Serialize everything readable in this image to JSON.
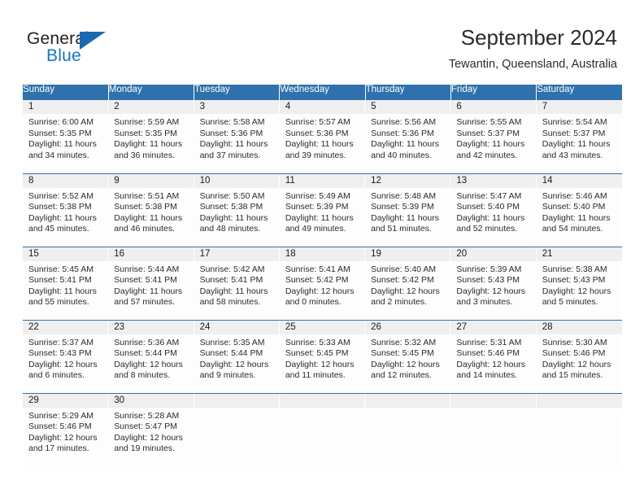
{
  "logo": {
    "word_top": "General",
    "word_bottom": "Blue",
    "triangle_color": "#1b69b0",
    "text_color": "#231f20",
    "blue_text_color": "#1278be"
  },
  "header": {
    "title": "September 2024",
    "subtitle": "Tewantin, Queensland, Australia"
  },
  "theme": {
    "header_blue": "#2f71ac",
    "daynum_band": "#efefef",
    "cell_background": "#fdfdfd",
    "text": "#2b2b2b"
  },
  "weekday_headers": [
    "Sunday",
    "Monday",
    "Tuesday",
    "Wednesday",
    "Thursday",
    "Friday",
    "Saturday"
  ],
  "weeks": [
    [
      {
        "day": "1",
        "sunrise": "Sunrise: 6:00 AM",
        "sunset": "Sunset: 5:35 PM",
        "daylight_line1": "Daylight: 11 hours",
        "daylight_line2": "and 34 minutes."
      },
      {
        "day": "2",
        "sunrise": "Sunrise: 5:59 AM",
        "sunset": "Sunset: 5:35 PM",
        "daylight_line1": "Daylight: 11 hours",
        "daylight_line2": "and 36 minutes."
      },
      {
        "day": "3",
        "sunrise": "Sunrise: 5:58 AM",
        "sunset": "Sunset: 5:36 PM",
        "daylight_line1": "Daylight: 11 hours",
        "daylight_line2": "and 37 minutes."
      },
      {
        "day": "4",
        "sunrise": "Sunrise: 5:57 AM",
        "sunset": "Sunset: 5:36 PM",
        "daylight_line1": "Daylight: 11 hours",
        "daylight_line2": "and 39 minutes."
      },
      {
        "day": "5",
        "sunrise": "Sunrise: 5:56 AM",
        "sunset": "Sunset: 5:36 PM",
        "daylight_line1": "Daylight: 11 hours",
        "daylight_line2": "and 40 minutes."
      },
      {
        "day": "6",
        "sunrise": "Sunrise: 5:55 AM",
        "sunset": "Sunset: 5:37 PM",
        "daylight_line1": "Daylight: 11 hours",
        "daylight_line2": "and 42 minutes."
      },
      {
        "day": "7",
        "sunrise": "Sunrise: 5:54 AM",
        "sunset": "Sunset: 5:37 PM",
        "daylight_line1": "Daylight: 11 hours",
        "daylight_line2": "and 43 minutes."
      }
    ],
    [
      {
        "day": "8",
        "sunrise": "Sunrise: 5:52 AM",
        "sunset": "Sunset: 5:38 PM",
        "daylight_line1": "Daylight: 11 hours",
        "daylight_line2": "and 45 minutes."
      },
      {
        "day": "9",
        "sunrise": "Sunrise: 5:51 AM",
        "sunset": "Sunset: 5:38 PM",
        "daylight_line1": "Daylight: 11 hours",
        "daylight_line2": "and 46 minutes."
      },
      {
        "day": "10",
        "sunrise": "Sunrise: 5:50 AM",
        "sunset": "Sunset: 5:38 PM",
        "daylight_line1": "Daylight: 11 hours",
        "daylight_line2": "and 48 minutes."
      },
      {
        "day": "11",
        "sunrise": "Sunrise: 5:49 AM",
        "sunset": "Sunset: 5:39 PM",
        "daylight_line1": "Daylight: 11 hours",
        "daylight_line2": "and 49 minutes."
      },
      {
        "day": "12",
        "sunrise": "Sunrise: 5:48 AM",
        "sunset": "Sunset: 5:39 PM",
        "daylight_line1": "Daylight: 11 hours",
        "daylight_line2": "and 51 minutes."
      },
      {
        "day": "13",
        "sunrise": "Sunrise: 5:47 AM",
        "sunset": "Sunset: 5:40 PM",
        "daylight_line1": "Daylight: 11 hours",
        "daylight_line2": "and 52 minutes."
      },
      {
        "day": "14",
        "sunrise": "Sunrise: 5:46 AM",
        "sunset": "Sunset: 5:40 PM",
        "daylight_line1": "Daylight: 11 hours",
        "daylight_line2": "and 54 minutes."
      }
    ],
    [
      {
        "day": "15",
        "sunrise": "Sunrise: 5:45 AM",
        "sunset": "Sunset: 5:41 PM",
        "daylight_line1": "Daylight: 11 hours",
        "daylight_line2": "and 55 minutes."
      },
      {
        "day": "16",
        "sunrise": "Sunrise: 5:44 AM",
        "sunset": "Sunset: 5:41 PM",
        "daylight_line1": "Daylight: 11 hours",
        "daylight_line2": "and 57 minutes."
      },
      {
        "day": "17",
        "sunrise": "Sunrise: 5:42 AM",
        "sunset": "Sunset: 5:41 PM",
        "daylight_line1": "Daylight: 11 hours",
        "daylight_line2": "and 58 minutes."
      },
      {
        "day": "18",
        "sunrise": "Sunrise: 5:41 AM",
        "sunset": "Sunset: 5:42 PM",
        "daylight_line1": "Daylight: 12 hours",
        "daylight_line2": "and 0 minutes."
      },
      {
        "day": "19",
        "sunrise": "Sunrise: 5:40 AM",
        "sunset": "Sunset: 5:42 PM",
        "daylight_line1": "Daylight: 12 hours",
        "daylight_line2": "and 2 minutes."
      },
      {
        "day": "20",
        "sunrise": "Sunrise: 5:39 AM",
        "sunset": "Sunset: 5:43 PM",
        "daylight_line1": "Daylight: 12 hours",
        "daylight_line2": "and 3 minutes."
      },
      {
        "day": "21",
        "sunrise": "Sunrise: 5:38 AM",
        "sunset": "Sunset: 5:43 PM",
        "daylight_line1": "Daylight: 12 hours",
        "daylight_line2": "and 5 minutes."
      }
    ],
    [
      {
        "day": "22",
        "sunrise": "Sunrise: 5:37 AM",
        "sunset": "Sunset: 5:43 PM",
        "daylight_line1": "Daylight: 12 hours",
        "daylight_line2": "and 6 minutes."
      },
      {
        "day": "23",
        "sunrise": "Sunrise: 5:36 AM",
        "sunset": "Sunset: 5:44 PM",
        "daylight_line1": "Daylight: 12 hours",
        "daylight_line2": "and 8 minutes."
      },
      {
        "day": "24",
        "sunrise": "Sunrise: 5:35 AM",
        "sunset": "Sunset: 5:44 PM",
        "daylight_line1": "Daylight: 12 hours",
        "daylight_line2": "and 9 minutes."
      },
      {
        "day": "25",
        "sunrise": "Sunrise: 5:33 AM",
        "sunset": "Sunset: 5:45 PM",
        "daylight_line1": "Daylight: 12 hours",
        "daylight_line2": "and 11 minutes."
      },
      {
        "day": "26",
        "sunrise": "Sunrise: 5:32 AM",
        "sunset": "Sunset: 5:45 PM",
        "daylight_line1": "Daylight: 12 hours",
        "daylight_line2": "and 12 minutes."
      },
      {
        "day": "27",
        "sunrise": "Sunrise: 5:31 AM",
        "sunset": "Sunset: 5:46 PM",
        "daylight_line1": "Daylight: 12 hours",
        "daylight_line2": "and 14 minutes."
      },
      {
        "day": "28",
        "sunrise": "Sunrise: 5:30 AM",
        "sunset": "Sunset: 5:46 PM",
        "daylight_line1": "Daylight: 12 hours",
        "daylight_line2": "and 15 minutes."
      }
    ],
    [
      {
        "day": "29",
        "sunrise": "Sunrise: 5:29 AM",
        "sunset": "Sunset: 5:46 PM",
        "daylight_line1": "Daylight: 12 hours",
        "daylight_line2": "and 17 minutes."
      },
      {
        "day": "30",
        "sunrise": "Sunrise: 5:28 AM",
        "sunset": "Sunset: 5:47 PM",
        "daylight_line1": "Daylight: 12 hours",
        "daylight_line2": "and 19 minutes."
      },
      {
        "day": "",
        "sunrise": "",
        "sunset": "",
        "daylight_line1": "",
        "daylight_line2": ""
      },
      {
        "day": "",
        "sunrise": "",
        "sunset": "",
        "daylight_line1": "",
        "daylight_line2": ""
      },
      {
        "day": "",
        "sunrise": "",
        "sunset": "",
        "daylight_line1": "",
        "daylight_line2": ""
      },
      {
        "day": "",
        "sunrise": "",
        "sunset": "",
        "daylight_line1": "",
        "daylight_line2": ""
      },
      {
        "day": "",
        "sunrise": "",
        "sunset": "",
        "daylight_line1": "",
        "daylight_line2": ""
      }
    ]
  ]
}
